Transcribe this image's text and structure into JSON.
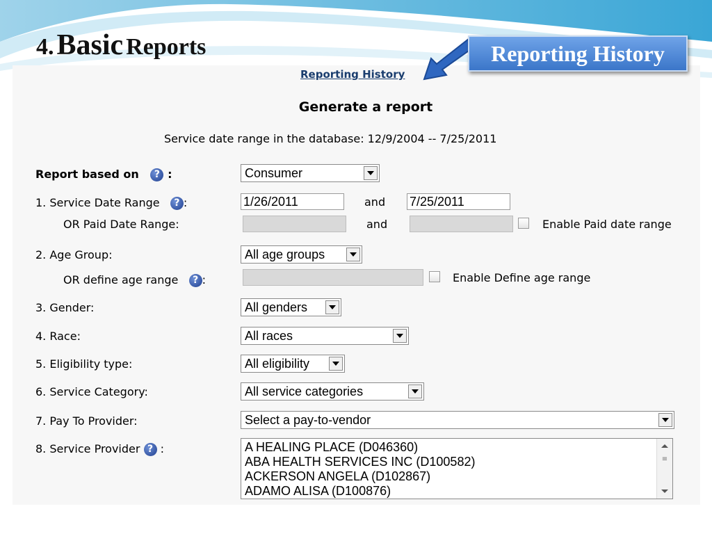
{
  "slide": {
    "number": "4.",
    "title_big": "Basic",
    "title_rest": "Reports",
    "callout": "Reporting History"
  },
  "form": {
    "history_link": "Reporting History",
    "heading": "Generate a report",
    "date_range_text": "Service date range in the database: 12/9/2004 -- 7/25/2011",
    "help_icon_glyph": "?",
    "report_based_on": {
      "label": "Report based on",
      "colon": ":",
      "value": "Consumer"
    },
    "service_date": {
      "label": "1.  Service Date Range",
      "colon": ":",
      "from": "1/26/2011",
      "and": "and",
      "to": "7/25/2011"
    },
    "paid_date": {
      "label": "OR Paid Date Range:",
      "and": "and",
      "enable_label": "Enable Paid date range"
    },
    "age_group": {
      "label": "2.  Age Group:",
      "value": "All age groups"
    },
    "define_age": {
      "label": "OR define age range",
      "colon": ":",
      "enable_label": "Enable Define age range"
    },
    "gender": {
      "label": "3.  Gender:",
      "value": "All genders"
    },
    "race": {
      "label": "4.  Race:",
      "value": "All races"
    },
    "eligibility": {
      "label": "5.  Eligibility type:",
      "value": "All eligibility"
    },
    "service_category": {
      "label": "6.  Service Category:",
      "value": "All service categories"
    },
    "pay_to_provider": {
      "label": "7.  Pay To Provider:",
      "value": "Select a pay-to-vendor"
    },
    "service_provider": {
      "label": "8.  Service Provider",
      "colon": ":",
      "options": [
        "A HEALING PLACE (D046360)",
        "ABA HEALTH SERVICES INC (D100582)",
        "ACKERSON ANGELA (D102867)",
        "ADAMO ALISA (D100876)"
      ]
    }
  }
}
